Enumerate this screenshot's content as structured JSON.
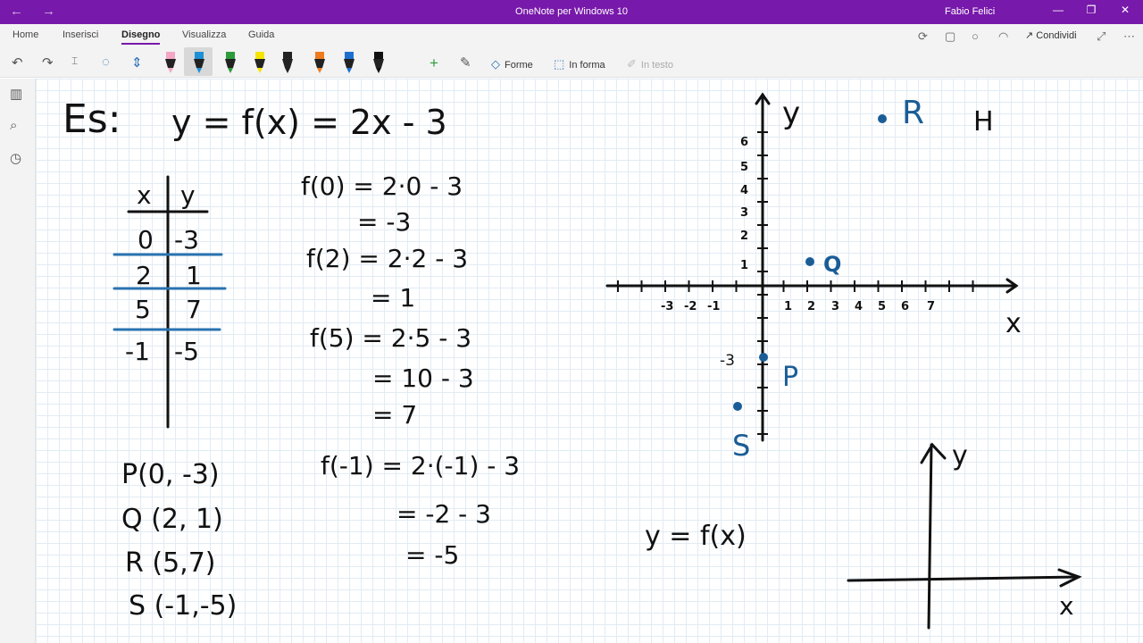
{
  "window": {
    "title": "OneNote per Windows 10",
    "user": "Fabio Felici",
    "nav_back": "←",
    "nav_forward": "→",
    "min": "—",
    "max": "❐",
    "close": "✕"
  },
  "ribbon": {
    "tabs": [
      "Home",
      "Inserisci",
      "Disegno",
      "Visualizza",
      "Guida"
    ],
    "share_label": "Condividi",
    "forme_label": "Forme",
    "in_forma_label": "In forma",
    "in_testo_label": "In testo",
    "pen_colors": [
      "#f4a7c4",
      "#1e90d6",
      "#2c9b3b",
      "#f5e400",
      "#222222",
      "#f07b1c",
      "#1f6fd1",
      "#111111"
    ]
  },
  "notes": {
    "title_left": "Es:",
    "title_eq": "y = f(x) = 2x - 3",
    "table_headers": [
      "x",
      "y"
    ],
    "table_rows": [
      [
        "0",
        "-3"
      ],
      [
        "2",
        "1"
      ],
      [
        "5",
        "7"
      ],
      [
        "-1",
        "-5"
      ]
    ],
    "calc_lines": [
      "f(0) = 2·0 - 3",
      "= -3",
      "f(2) = 2·2 - 3",
      "= 1",
      "f(5) = 2·5 - 3",
      "= 10 - 3",
      "= 7",
      "f(-1) = 2·(-1) - 3",
      "= -2 - 3",
      "= -5"
    ],
    "points": [
      "P(0, -3)",
      "Q (2, 1)",
      "R (5,7)",
      "S (-1,-5)"
    ],
    "function_label": "y = f(x)",
    "ink_color": "#111111",
    "blue_color": "#1a5d96",
    "line_color": "#2a73b0"
  },
  "graph": {
    "y_label": "y",
    "x_label": "x",
    "x_ticks_neg": [
      "-3",
      "-2",
      "-1"
    ],
    "x_ticks_pos": [
      "1",
      "2",
      "3",
      "4",
      "5",
      "6",
      "7"
    ],
    "y_ticks": [
      "1",
      "2",
      "3",
      "4",
      "5",
      "6"
    ],
    "y_tick_neg": "-3",
    "point_labels": [
      "R",
      "Q",
      "P",
      "S"
    ],
    "corner_mark": "H"
  },
  "graph2": {
    "y_label": "y",
    "x_label": "x"
  }
}
